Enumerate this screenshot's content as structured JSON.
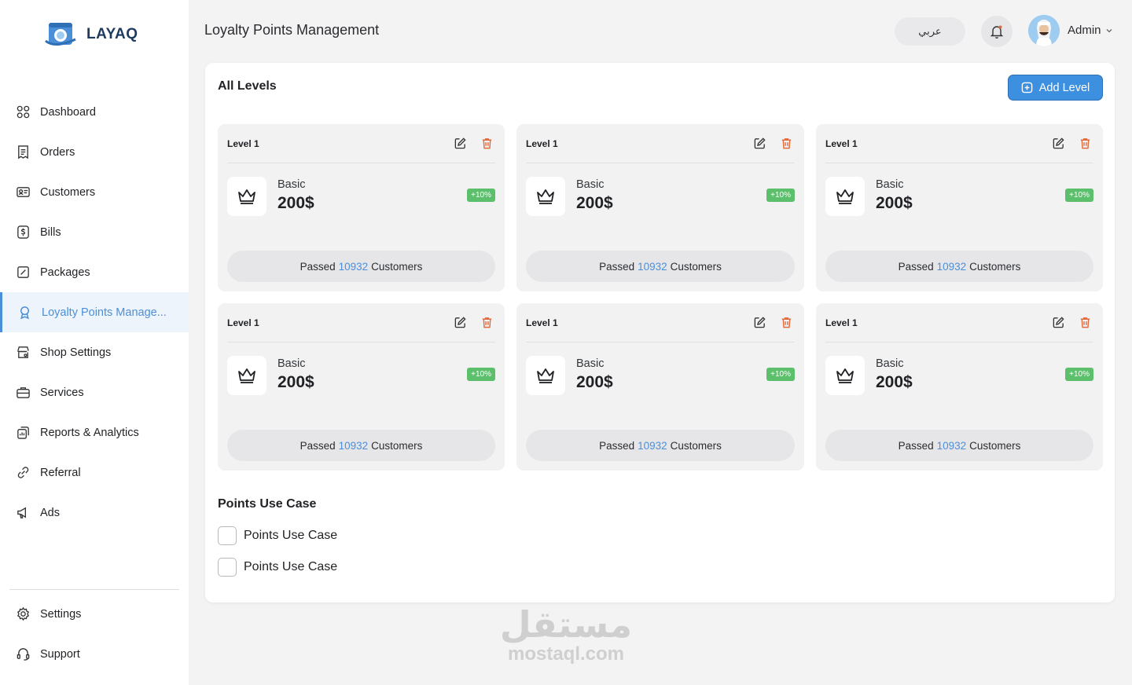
{
  "brand": {
    "name": "LAYAQ"
  },
  "header": {
    "title": "Loyalty Points Management",
    "language_button": "عربي",
    "user_name": "Admin"
  },
  "sidebar": {
    "items": [
      {
        "label": "Dashboard",
        "icon": "grid-icon"
      },
      {
        "label": "Orders",
        "icon": "receipt-icon"
      },
      {
        "label": "Customers",
        "icon": "id-card-icon"
      },
      {
        "label": "Bills",
        "icon": "dollar-icon"
      },
      {
        "label": "Packages",
        "icon": "package-icon"
      },
      {
        "label": "Loyalty Points Manage...",
        "icon": "award-icon",
        "active": true
      },
      {
        "label": "Shop Settings",
        "icon": "shop-icon"
      },
      {
        "label": "Services",
        "icon": "briefcase-icon"
      },
      {
        "label": "Reports & Analytics",
        "icon": "report-icon"
      },
      {
        "label": "Referral",
        "icon": "link-icon"
      },
      {
        "label": "Ads",
        "icon": "megaphone-icon"
      }
    ],
    "bottom_items": [
      {
        "label": "Settings",
        "icon": "gear-icon"
      },
      {
        "label": "Support",
        "icon": "headset-icon"
      }
    ]
  },
  "main": {
    "section_title": "All Levels",
    "add_button": "Add Level",
    "levels": [
      {
        "title": "Level 1",
        "name": "Basic",
        "price": "200$",
        "badge": "+10%",
        "passed_prefix": "Passed",
        "passed_count": "10932",
        "passed_suffix": "Customers"
      },
      {
        "title": "Level 1",
        "name": "Basic",
        "price": "200$",
        "badge": "+10%",
        "passed_prefix": "Passed",
        "passed_count": "10932",
        "passed_suffix": "Customers"
      },
      {
        "title": "Level 1",
        "name": "Basic",
        "price": "200$",
        "badge": "+10%",
        "passed_prefix": "Passed",
        "passed_count": "10932",
        "passed_suffix": "Customers"
      },
      {
        "title": "Level 1",
        "name": "Basic",
        "price": "200$",
        "badge": "+10%",
        "passed_prefix": "Passed",
        "passed_count": "10932",
        "passed_suffix": "Customers"
      },
      {
        "title": "Level 1",
        "name": "Basic",
        "price": "200$",
        "badge": "+10%",
        "passed_prefix": "Passed",
        "passed_count": "10932",
        "passed_suffix": "Customers"
      },
      {
        "title": "Level 1",
        "name": "Basic",
        "price": "200$",
        "badge": "+10%",
        "passed_prefix": "Passed",
        "passed_count": "10932",
        "passed_suffix": "Customers"
      }
    ],
    "use_case_title": "Points Use Case",
    "use_cases": [
      {
        "label": "Points Use Case",
        "checked": false
      },
      {
        "label": "Points Use Case",
        "checked": false
      }
    ]
  },
  "watermark": {
    "arabic": "مستقل",
    "latin": "mostaql.com"
  },
  "colors": {
    "accent": "#4b8fd9",
    "button": "#3d8fe0",
    "badge": "#5bbf6b",
    "delete": "#e06a3b"
  }
}
